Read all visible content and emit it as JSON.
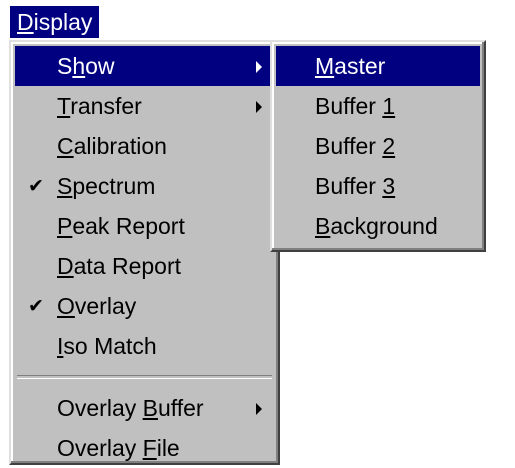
{
  "menubar": {
    "display": {
      "pre": "",
      "acc": "D",
      "post": "isplay"
    }
  },
  "main_menu": {
    "items": [
      {
        "pre": "S",
        "acc": "h",
        "post": "ow",
        "checked": false,
        "submenu": true,
        "highlighted": true
      },
      {
        "pre": "",
        "acc": "T",
        "post": "ransfer",
        "checked": false,
        "submenu": true
      },
      {
        "pre": "",
        "acc": "C",
        "post": "alibration",
        "checked": false,
        "submenu": false
      },
      {
        "pre": "",
        "acc": "S",
        "post": "pectrum",
        "checked": true,
        "submenu": false
      },
      {
        "pre": "",
        "acc": "P",
        "post": "eak Report",
        "checked": false,
        "submenu": false
      },
      {
        "pre": "",
        "acc": "D",
        "post": "ata Report",
        "checked": false,
        "submenu": false
      },
      {
        "pre": "",
        "acc": "O",
        "post": "verlay",
        "checked": true,
        "submenu": false
      },
      {
        "pre": "",
        "acc": "I",
        "post": "so Match",
        "checked": false,
        "submenu": false
      },
      {
        "pre": "Overlay ",
        "acc": "B",
        "post": "uffer",
        "checked": false,
        "submenu": true
      },
      {
        "pre": "Overlay ",
        "acc": "F",
        "post": "ile",
        "checked": false,
        "submenu": false
      }
    ],
    "check_glyph": "✔"
  },
  "show_submenu": {
    "items": [
      {
        "pre": "",
        "acc": "M",
        "post": "aster",
        "highlighted": true
      },
      {
        "pre": "Buffer ",
        "acc": "1",
        "post": ""
      },
      {
        "pre": "Buffer ",
        "acc": "2",
        "post": ""
      },
      {
        "pre": "Buffer ",
        "acc": "3",
        "post": ""
      },
      {
        "pre": "",
        "acc": "B",
        "post": "ackground"
      }
    ]
  },
  "icons": {
    "check": "check-icon",
    "submenu_arrow": "submenu-arrow-icon"
  },
  "colors": {
    "menu_bg": "#c0c0c0",
    "highlight": "#000080",
    "highlight_text": "#ffffff"
  }
}
